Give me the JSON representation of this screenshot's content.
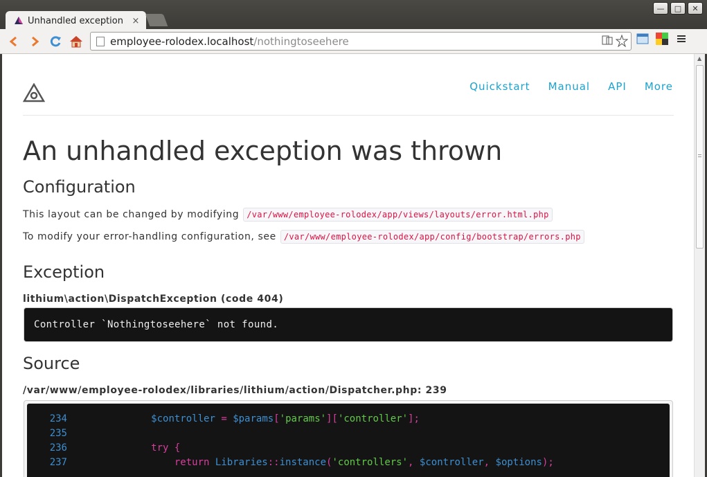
{
  "window": {
    "tab_title": "Unhandled exception",
    "tab_close": "×",
    "min": "—",
    "max": "□",
    "close": "✕"
  },
  "toolbar": {
    "url_host": "employee-rolodex.localhost",
    "url_path": "/nothingtoseehere"
  },
  "nav": {
    "items": [
      "Quickstart",
      "Manual",
      "API",
      "More"
    ]
  },
  "page": {
    "title": "An unhandled exception was thrown",
    "configuration": {
      "heading": "Configuration",
      "line1_text": "This layout can be changed by modifying",
      "line1_code": "/var/www/employee-rolodex/app/views/layouts/error.html.php",
      "line2_text": "To modify your error-handling configuration, see",
      "line2_code": "/var/www/employee-rolodex/app/config/bootstrap/errors.php"
    },
    "exception": {
      "heading": "Exception",
      "class_line": "lithium\\action\\DispatchException (code 404)",
      "message": "Controller `Nothingtoseehere` not found."
    },
    "source": {
      "heading": "Source",
      "file_line": "/var/www/employee-rolodex/libraries/lithium/action/Dispatcher.php: 239",
      "line_numbers": [
        "234",
        "235",
        "236",
        "237"
      ]
    }
  },
  "colors": {
    "link": "#1aa3d1",
    "code_bg": "#141414",
    "inline_code": "#d14"
  }
}
